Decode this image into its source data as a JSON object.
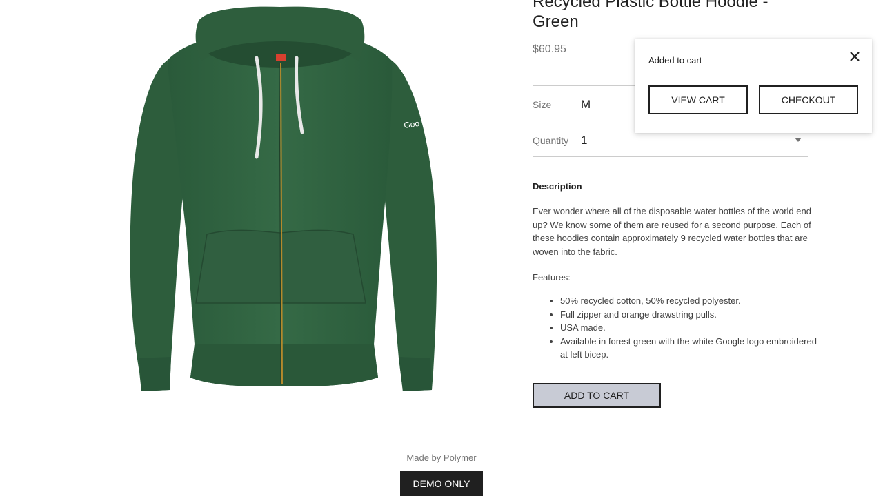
{
  "product": {
    "title": "Recycled Plastic Bottle Hoodie - Green",
    "price": "$60.95",
    "image_alt": "green zip hoodie",
    "colors": {
      "hoodie": "#2f5f3f",
      "accent_button": "#c8cbd5"
    }
  },
  "options": {
    "size_label": "Size",
    "size_value": "M",
    "quantity_label": "Quantity",
    "quantity_value": "1"
  },
  "description": {
    "heading": "Description",
    "text": "Ever wonder where all of the disposable water bottles of the world end up? We know some of them are reused for a second purpose. Each of these hoodies contain approximately 9 recycled water bottles that are woven into the fabric.",
    "features_label": "Features:",
    "features": [
      "50% recycled cotton, 50% recycled polyester.",
      "Full zipper and orange drawstring pulls.",
      "USA made.",
      " Available in forest green with the white Google logo embroidered at left bicep."
    ]
  },
  "actions": {
    "add_to_cart": "ADD TO CART"
  },
  "toast": {
    "message": "Added to cart",
    "view_cart": "VIEW CART",
    "checkout": "CHECKOUT",
    "close_icon": "close-icon"
  },
  "footer": {
    "made_by": "Made by Polymer",
    "demo_badge": "DEMO ONLY"
  }
}
